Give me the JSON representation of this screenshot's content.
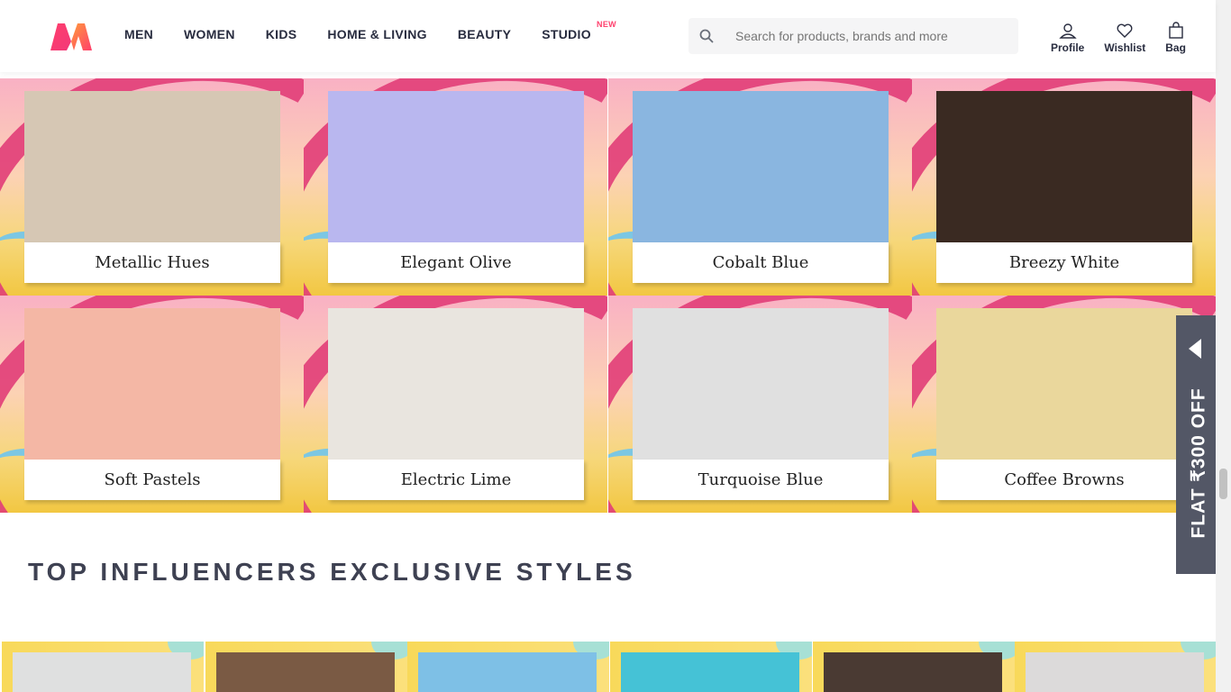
{
  "header": {
    "nav": [
      "MEN",
      "WOMEN",
      "KIDS",
      "HOME & LIVING",
      "BEAUTY",
      "STUDIO"
    ],
    "studio_badge": "NEW",
    "search_placeholder": "Search for products, brands and more",
    "actions": {
      "profile": "Profile",
      "wishlist": "Wishlist",
      "bag": "Bag"
    }
  },
  "color_tiles": [
    {
      "label": "Metallic Hues",
      "photo_color": "#d6c7b4"
    },
    {
      "label": "Elegant Olive",
      "photo_color": "#b9b7ef"
    },
    {
      "label": "Cobalt Blue",
      "photo_color": "#8ab6e0"
    },
    {
      "label": "Breezy White",
      "photo_color": "#3a2a22"
    },
    {
      "label": "Soft Pastels",
      "photo_color": "#f4b7a5"
    },
    {
      "label": "Electric Lime",
      "photo_color": "#e9e5df"
    },
    {
      "label": "Turquoise Blue",
      "photo_color": "#e0e0e0"
    },
    {
      "label": "Coffee Browns",
      "photo_color": "#ead79c"
    }
  ],
  "section": {
    "title": "TOP INFLUENCERS EXCLUSIVE STYLES"
  },
  "influencer_cards": [
    {
      "photo_color": "#dfe0e0"
    },
    {
      "photo_color": "#7a5a44"
    },
    {
      "photo_color": "#7ec0e6"
    },
    {
      "photo_color": "#45c2d6"
    },
    {
      "photo_color": "#4a3a33"
    },
    {
      "photo_color": "#dcdada"
    }
  ],
  "coupon": {
    "text": "FLAT ₹300 OFF"
  },
  "colors": {
    "brand": "#ff3f6c",
    "text": "#282c3f",
    "coupon_bg": "#535766"
  }
}
